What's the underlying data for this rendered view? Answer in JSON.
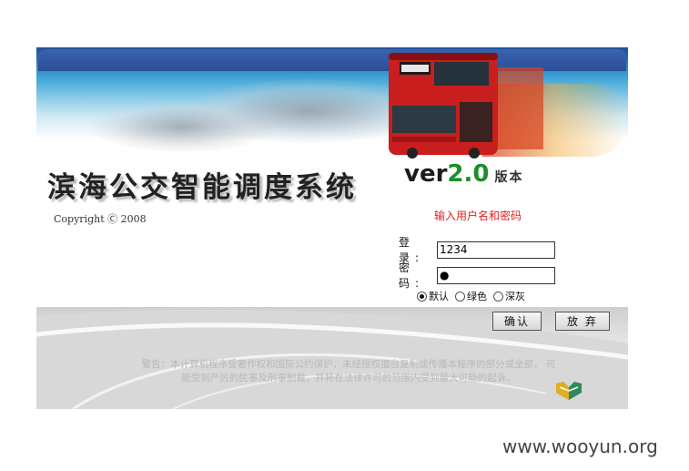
{
  "header": {
    "system_title": "滨海公交智能调度系统",
    "version_prefix": "ver",
    "version_number": "2.0",
    "version_suffix": "版本",
    "copyright": "Copyright Ⓒ 2008"
  },
  "login": {
    "hint": "输入用户名和密码",
    "username_label": "登 录:",
    "username_value": "1234",
    "password_label": "密 码:",
    "password_value": "●",
    "themes": [
      {
        "label": "默认",
        "checked": true
      },
      {
        "label": "绿色",
        "checked": false
      },
      {
        "label": "深灰",
        "checked": false
      }
    ],
    "confirm_label": "确认",
    "cancel_label": "放 弃"
  },
  "footer": {
    "warning_line1": "警告：本计算机程序受著作权和国际公约保护，未经授权擅自复制或传播本程序的部分或全部， 可",
    "warning_line2": "能受到严厉的民事及刑事制裁，并将在法律许可的范围内受到最大可能的起诉。"
  },
  "watermark": "www.wooyun.org",
  "colors": {
    "hint_red": "#e02020",
    "version_green": "#1a8f2a",
    "banner_blue": "#2a7cc0"
  }
}
